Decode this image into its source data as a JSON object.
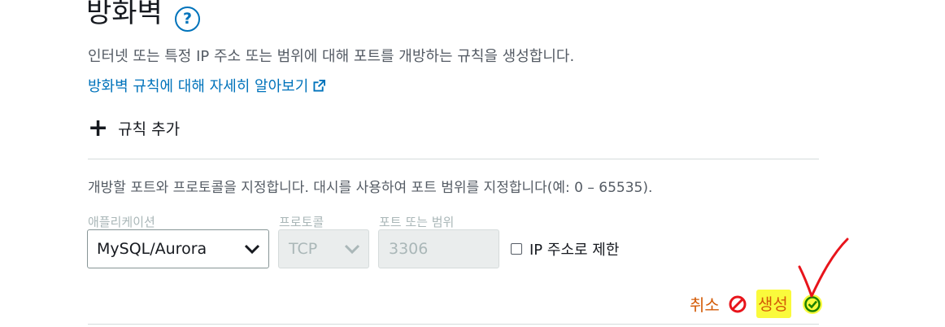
{
  "section": {
    "title": "방화벽",
    "description": "인터넷 또는 특정 IP 주소 또는 범위에 대해 포트를 개방하는 규칙을 생성합니다.",
    "learn_more": "방화벽 규칙에 대해 자세히 알아보기",
    "add_rule": "규칙 추가"
  },
  "form": {
    "instructions": "개방할 포트와 프로토콜을 지정합니다. 대시를 사용하여 포트 범위를 지정합니다(예: 0 – 65535).",
    "application": {
      "label": "애플리케이션",
      "value": "MySQL/Aurora"
    },
    "protocol": {
      "label": "프로토콜",
      "value": "TCP"
    },
    "port_range": {
      "label": "포트 또는 범위",
      "value": "3306"
    },
    "restrict_ip": {
      "label": "IP 주소로 제한",
      "checked": false
    }
  },
  "actions": {
    "cancel": "취소",
    "create": "생성"
  },
  "colors": {
    "link": "#0073bb",
    "action": "#d45b07",
    "highlight": "#fafa3c",
    "annotation": "#e8141b",
    "create_icon": "#1d8102"
  },
  "icons": [
    "help-icon",
    "external-link-icon",
    "plus-icon",
    "chevron-down-icon",
    "cancel-icon",
    "check-circle-icon"
  ]
}
